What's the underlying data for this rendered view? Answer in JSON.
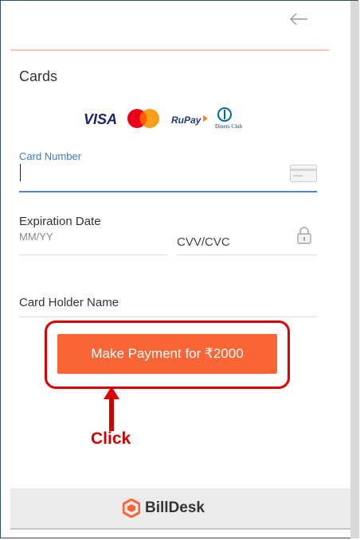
{
  "header": {
    "back_icon": "arrow-left-icon"
  },
  "cards_section": {
    "title": "Cards",
    "logos": [
      "VISA",
      "Mastercard",
      "RuPay",
      "Diners Club"
    ]
  },
  "form": {
    "card_number_label": "Card Number",
    "card_number_value": "",
    "expiration_label": "Expiration Date",
    "expiration_placeholder": "MM/YY",
    "cvv_placeholder": "CVV/CVC",
    "card_holder_placeholder": "Card Holder Name"
  },
  "pay_button": {
    "label": "Make Payment for ₹2000"
  },
  "annotation": {
    "click_label": "Click",
    "color": "#d40000"
  },
  "footer": {
    "brand": "BillDesk",
    "accent": "#fa6535"
  }
}
